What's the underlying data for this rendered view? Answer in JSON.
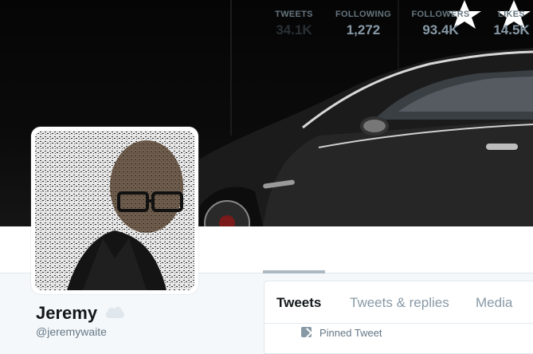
{
  "profile": {
    "name": "Jeremy",
    "handle": "@jeremywaite"
  },
  "stats": [
    {
      "label": "TWEETS",
      "value": "34.1K",
      "active": true
    },
    {
      "label": "FOLLOWING",
      "value": "1,272",
      "active": false
    },
    {
      "label": "FOLLOWERS",
      "value": "93.4K",
      "active": false
    },
    {
      "label": "LIKES",
      "value": "14.5K",
      "active": false
    }
  ],
  "feed": {
    "tabs": [
      "Tweets",
      "Tweets & replies",
      "Media"
    ],
    "pinned_label": "Pinned Tweet"
  },
  "colors": {
    "active_underline": "#adb9c2",
    "stat_label": "#66757f",
    "stat_value_inactive": "#8899a6",
    "stat_value_active": "#292f33"
  }
}
